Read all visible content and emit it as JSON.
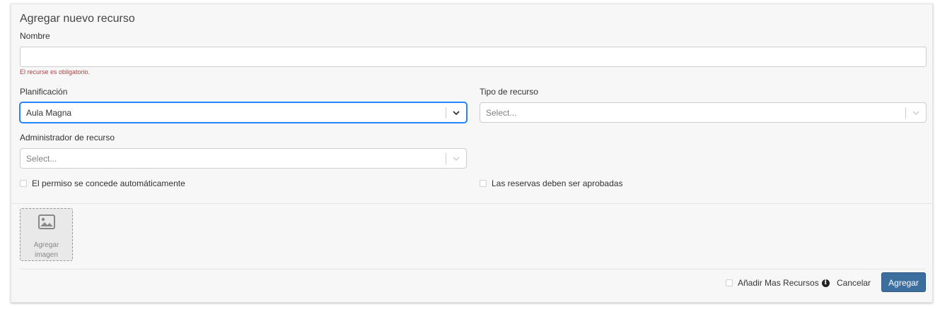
{
  "form": {
    "title": "Agregar nuevo recurso",
    "name_label": "Nombre",
    "name_value": "",
    "name_error": "El recurse es obligatorio.",
    "schedule_label": "Planificación",
    "schedule_value": "Aula Magna",
    "type_label": "Tipo de recurso",
    "type_placeholder": "Select...",
    "admin_label": "Administrador de recurso",
    "admin_placeholder": "Select...",
    "auto_permission_label": "El permiso se concede automáticamente",
    "approval_label": "Las reservas deben ser aprobadas"
  },
  "image_upload": {
    "line1": "Agregar",
    "line2": "imagen",
    "icon": "image-icon"
  },
  "footer": {
    "add_more_label": "Añadir Mas Recursos",
    "info_icon": "info-icon",
    "cancel_label": "Cancelar",
    "submit_label": "Agregar"
  },
  "colors": {
    "primary_button": "#3d6f9e",
    "focus_border": "#2684ff",
    "error_text": "#a94442"
  }
}
